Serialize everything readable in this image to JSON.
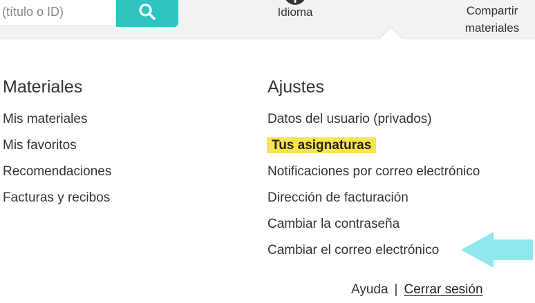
{
  "header": {
    "search_placeholder": "(título o ID)",
    "language_label": "Idioma",
    "share_label": "Compartir materiales"
  },
  "menu": {
    "materials": {
      "heading": "Materiales",
      "items": [
        "Mis materiales",
        "Mis favoritos",
        "Recomendaciones",
        "Facturas y recibos"
      ]
    },
    "settings": {
      "heading": "Ajustes",
      "items": [
        "Datos del usuario (privados)",
        "Tus asignaturas",
        "Notificaciones por correo electrónico",
        "Dirección de facturación",
        "Cambiar la contraseña",
        "Cambiar el correo electrónico"
      ]
    }
  },
  "footer": {
    "help": "Ayuda",
    "separator": "|",
    "logout": "Cerrar sesión"
  },
  "colors": {
    "accent": "#2ec4c0",
    "highlight": "#f9e44c",
    "pointer_arrow": "#8ee8ec"
  },
  "icons": {
    "search": "search-icon",
    "language": "globe-icon",
    "pointer": "arrow-left-icon"
  }
}
